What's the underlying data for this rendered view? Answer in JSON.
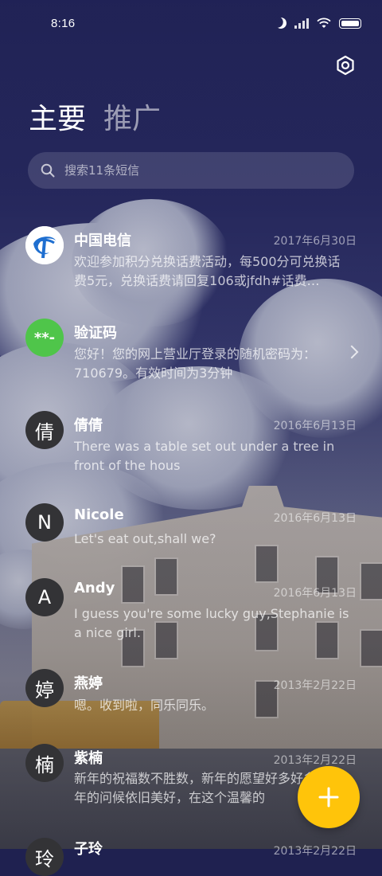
{
  "status_bar": {
    "time": "8:16",
    "icons": [
      "moon-icon",
      "signal-icon",
      "wifi-icon",
      "battery-icon"
    ]
  },
  "header": {
    "settings_icon": "settings-icon",
    "tabs": [
      {
        "label": "主要",
        "active": true
      },
      {
        "label": "推广",
        "active": false
      }
    ]
  },
  "search": {
    "placeholder": "搜索11条短信"
  },
  "conversations": [
    {
      "name": "中国电信",
      "date": "2017年6月30日",
      "preview": "欢迎参加积分兑换话费活动，每500分可兑换话费5元，兑换话费请回复106或jfdh#话费…",
      "avatar": {
        "type": "logo",
        "color": "#ffffff"
      }
    },
    {
      "name": "验证码",
      "date": "",
      "preview": "您好！您的网上营业厅登录的随机密码为：710679。有效时间为3分钟",
      "avatar": {
        "type": "text",
        "text": "**-",
        "color": "#4fc54a"
      },
      "chevron": true
    },
    {
      "name": "倩倩",
      "date": "2016年6月13日",
      "preview": "There was a table set out under a tree in front of the hous",
      "avatar": {
        "type": "text",
        "text": "倩",
        "color": "#3a3a3a"
      }
    },
    {
      "name": "Nicole",
      "date": "2016年6月13日",
      "preview": "Let's eat out,shall we?",
      "avatar": {
        "type": "text",
        "text": "N",
        "color": "#3a3a3a"
      }
    },
    {
      "name": "Andy",
      "date": "2016年6月13日",
      "preview": "I guess you're some lucky guy,Stephanie is a nice girl.",
      "avatar": {
        "type": "text",
        "text": "A",
        "color": "#3a3a3a"
      }
    },
    {
      "name": "燕婷",
      "date": "2013年2月22日",
      "preview": "嗯。收到啦，同乐同乐。",
      "avatar": {
        "type": "text",
        "text": "婷",
        "color": "#3a3a3a"
      }
    },
    {
      "name": "紫楠",
      "date": "2013年2月22日",
      "preview": "新年的祝福数不胜数，新年的愿望好多好多，新年的问候依旧美好，在这个温馨的",
      "avatar": {
        "type": "text",
        "text": "楠",
        "color": "#3a3a3a"
      }
    },
    {
      "name": "子玲",
      "date": "2013年2月22日",
      "preview": "",
      "avatar": {
        "type": "text",
        "text": "玲",
        "color": "#3a3a3a"
      }
    }
  ],
  "fab": {
    "icon": "plus-icon",
    "color": "#ffc40a"
  }
}
